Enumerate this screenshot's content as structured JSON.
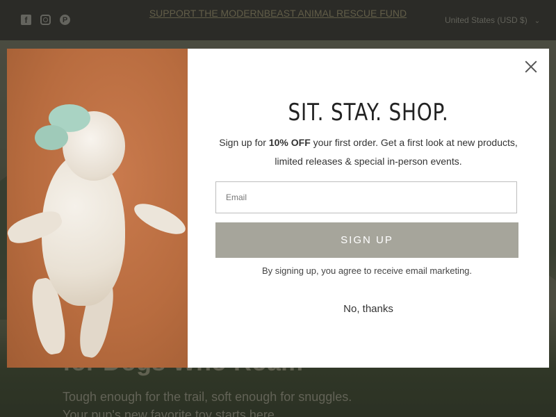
{
  "announcement": "SUPPORT THE MODERNBEAST ANIMAL RESCUE FUND",
  "currency": "United States (USD $)",
  "social": [
    "facebook-icon",
    "instagram-icon",
    "pinterest-icon"
  ],
  "hero": {
    "title": "for Dogs Who Roam",
    "copy_line1": "Tough enough for the trail, soft enough for snuggles.",
    "copy_line2": "Your pup's new favorite toy starts here."
  },
  "popup": {
    "headline": "SIT.  STAY.  SHOP.",
    "sub_prefix": "Sign up for ",
    "sub_bold": "10% OFF",
    "sub_suffix": " your first order.  Get a first look at new products, limited releases & special in-person events.",
    "email_placeholder": "Email",
    "signup_label": "SIGN UP",
    "legal": "By signing up, you agree to receive email marketing.",
    "dismiss": "No, thanks"
  },
  "colors": {
    "topbar": "#383833",
    "button": "#a6a59b",
    "announcement": "#8b8466"
  }
}
